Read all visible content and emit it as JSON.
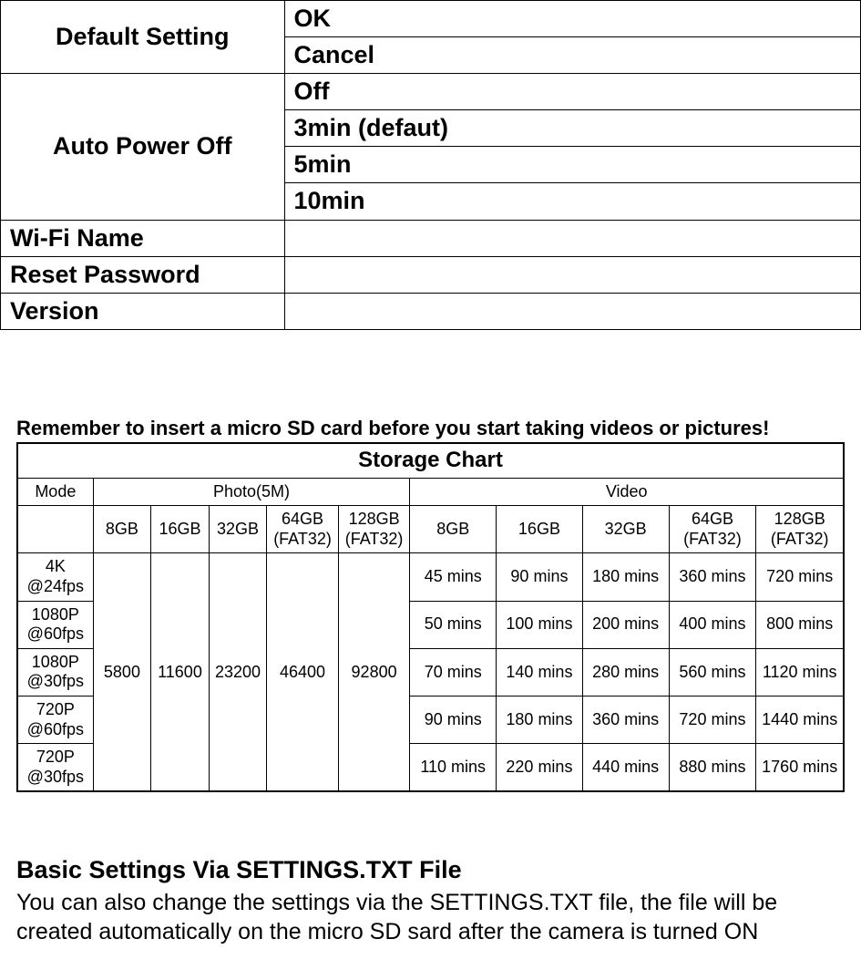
{
  "settings": {
    "default_setting": {
      "label": "Default Setting",
      "opt1": "OK",
      "opt2": "Cancel"
    },
    "auto_power_off": {
      "label": "Auto Power Off",
      "opt1": "Off",
      "opt2": "3min (defaut)",
      "opt3": "5min",
      "opt4": "10min"
    },
    "wifi_name": {
      "label": "Wi-Fi Name",
      "value": ""
    },
    "reset_password": {
      "label": "Reset Password",
      "value": ""
    },
    "version": {
      "label": "Version",
      "value": ""
    }
  },
  "reminder": "Remember to insert a micro SD card before you start taking videos or pictures!",
  "chart_data": {
    "type": "table",
    "title": "Storage Chart",
    "mode_label": "Mode",
    "photo_label": "Photo(5M)",
    "video_label": "Video",
    "capacities": {
      "c1": "8GB",
      "c2": "16GB",
      "c3": "32GB",
      "c4": "64GB (FAT32)",
      "c5": "128GB (FAT32)"
    },
    "modes": {
      "m1": "4K @24fps",
      "m2": "1080P @60fps",
      "m3": "1080P @30fps",
      "m4": "720P @60fps",
      "m5": "720P @30fps"
    },
    "photo_counts": {
      "p1": "5800",
      "p2": "11600",
      "p3": "23200",
      "p4": "46400",
      "p5": "92800"
    },
    "video": {
      "m1": {
        "v1": "45 mins",
        "v2": "90 mins",
        "v3": "180 mins",
        "v4": "360 mins",
        "v5": "720 mins"
      },
      "m2": {
        "v1": "50 mins",
        "v2": "100 mins",
        "v3": "200 mins",
        "v4": "400 mins",
        "v5": "800 mins"
      },
      "m3": {
        "v1": "70 mins",
        "v2": "140 mins",
        "v3": "280 mins",
        "v4": "560 mins",
        "v5": "1120 mins"
      },
      "m4": {
        "v1": "90 mins",
        "v2": "180 mins",
        "v3": "360 mins",
        "v4": "720 mins",
        "v5": "1440 mins"
      },
      "m5": {
        "v1": "110 mins",
        "v2": "220 mins",
        "v3": "440 mins",
        "v4": "880 mins",
        "v5": "1760 mins"
      }
    }
  },
  "section": {
    "heading": "Basic Settings Via SETTINGS.TXT File",
    "body": "You can also change the settings via the SETTINGS.TXT file, the file will be created automatically on the micro SD sard after the camera is turned ON"
  }
}
